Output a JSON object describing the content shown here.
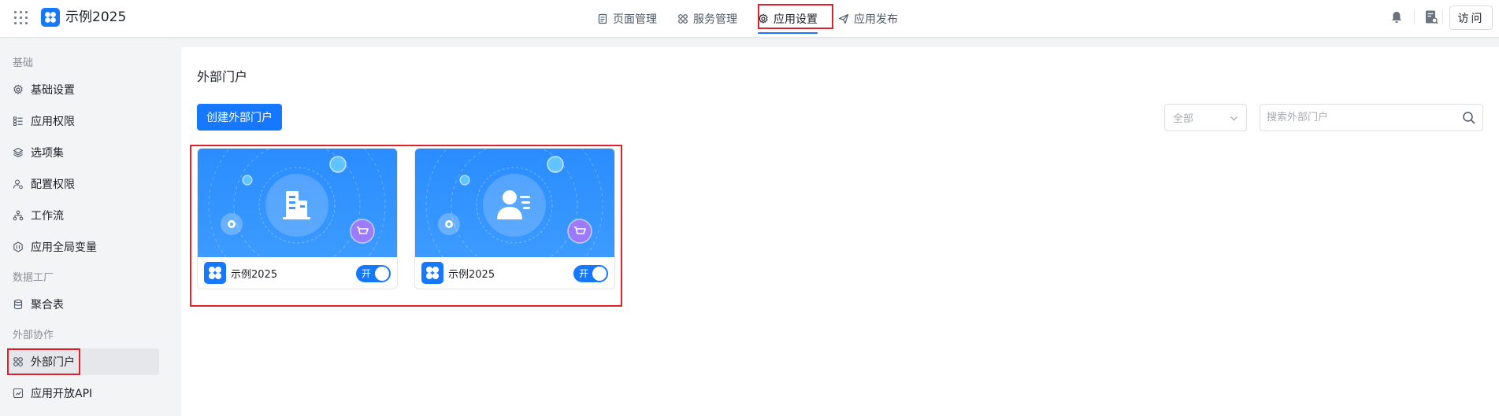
{
  "app": {
    "name": "示例2025"
  },
  "nav": {
    "tabs": [
      {
        "label": "页面管理",
        "icon": "document-icon"
      },
      {
        "label": "服务管理",
        "icon": "apps-icon"
      },
      {
        "label": "应用设置",
        "icon": "gear-icon",
        "active": true
      },
      {
        "label": "应用发布",
        "icon": "send-icon"
      }
    ],
    "visit_label": "访问"
  },
  "sidebar": {
    "groups": [
      {
        "title": "基础",
        "items": [
          {
            "label": "基础设置",
            "icon": "gear-icon"
          },
          {
            "label": "应用权限",
            "icon": "list-icon"
          },
          {
            "label": "选项集",
            "icon": "layers-icon"
          },
          {
            "label": "配置权限",
            "icon": "user-gear-icon"
          },
          {
            "label": "工作流",
            "icon": "workflow-icon"
          },
          {
            "label": "应用全局变量",
            "icon": "hexagon-icon"
          }
        ]
      },
      {
        "title": "数据工厂",
        "items": [
          {
            "label": "聚合表",
            "icon": "database-icon"
          }
        ]
      },
      {
        "title": "外部协作",
        "items": [
          {
            "label": "外部门户",
            "icon": "apps-icon",
            "active": true
          },
          {
            "label": "应用开放API",
            "icon": "api-icon"
          }
        ]
      }
    ]
  },
  "main": {
    "title": "外部门户",
    "create_label": "创建外部门户",
    "filter": {
      "value": "全部"
    },
    "search": {
      "placeholder": "搜索外部门户"
    },
    "portals": [
      {
        "name": "示例2025",
        "cover_icon": "building-icon",
        "enabled": true,
        "toggle_label": "开"
      },
      {
        "name": "示例2025",
        "cover_icon": "person-list-icon",
        "enabled": true,
        "toggle_label": "开"
      }
    ]
  },
  "colors": {
    "accent": "#1677ff",
    "highlight": "#e0202b",
    "sidebar_bg": "#f3f4f6"
  }
}
